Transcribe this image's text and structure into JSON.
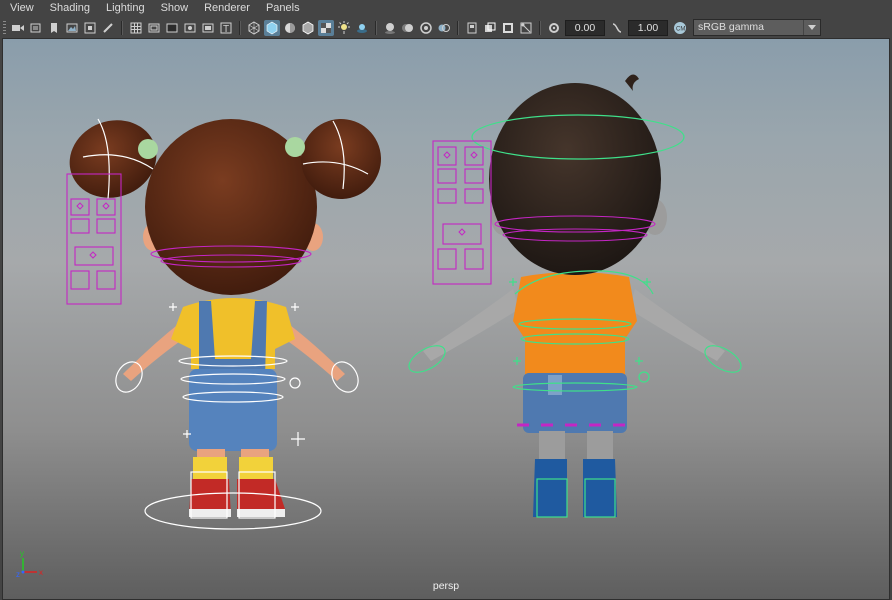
{
  "menu": {
    "items": [
      "View",
      "Shading",
      "Lighting",
      "Show",
      "Renderer",
      "Panels"
    ]
  },
  "toolbar": {
    "exposure_value": "0.00",
    "gamma_value": "1.00",
    "color_space": "sRGB gamma",
    "icons": [
      "camera-select-icon",
      "camera-attributes-icon",
      "bookmarks-icon",
      "image-plane-icon",
      "2d-pan-zoom-icon",
      "grease-pencil-icon",
      "grid-icon",
      "film-gate-icon",
      "resolution-gate-icon",
      "gate-mask-icon",
      "field-chart-icon",
      "safe-action-icon",
      "safe-title-icon",
      "wireframe-icon",
      "smooth-shade-icon",
      "default-material-icon",
      "wireframe-on-shaded-icon",
      "textured-icon",
      "use-all-lights-icon",
      "shadows-icon",
      "screen-space-ao-icon",
      "motion-blur-icon",
      "multisample-aa-icon",
      "depth-of-field-icon",
      "isolate-select-icon",
      "xray-icon",
      "xray-active-components-icon",
      "xray-joints-icon",
      "exposure-icon",
      "gamma-icon",
      "color-management-icon"
    ],
    "colors": {
      "active": "#5a7f98"
    }
  },
  "viewport": {
    "camera_label": "persp",
    "axis": {
      "x": "x",
      "y": "y",
      "z": "z"
    },
    "colors": {
      "control_magenta": "#c426c4",
      "control_green": "#3fe08a",
      "control_white": "#ffffff",
      "girl_hair": "#5a2a16",
      "girl_shirt": "#f0c02a",
      "shorts_blue": "#4f79b0",
      "boy_hair": "#2f221b",
      "boy_shirt": "#f28a1c",
      "skin": "#e9a37f",
      "boy_skin": "#9c9c9c"
    }
  }
}
